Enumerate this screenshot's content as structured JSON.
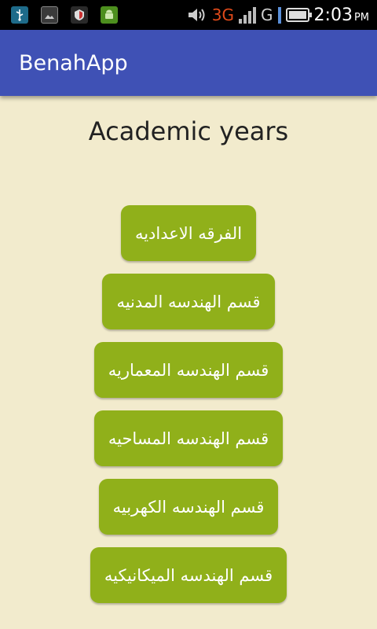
{
  "status_bar": {
    "icons": [
      "usb-icon",
      "image-icon",
      "shield-icon",
      "android-icon"
    ],
    "network_3g": "3G",
    "network_g": "G",
    "time": "2:03",
    "ampm": "PM"
  },
  "app_bar": {
    "title": "BenahApp"
  },
  "main": {
    "heading": "Academic years",
    "buttons": [
      "الفرقه الاعداديه",
      "قسم الهندسه المدنيه",
      "قسم الهندسه المعماريه",
      "قسم الهندسه المساحيه",
      "قسم الهندسه الكهربيه",
      "قسم الهندسه الميكانيكيه"
    ]
  },
  "colors": {
    "app_bar": "#3f51b5",
    "background": "#f2ebcd",
    "button": "#90b01a"
  }
}
